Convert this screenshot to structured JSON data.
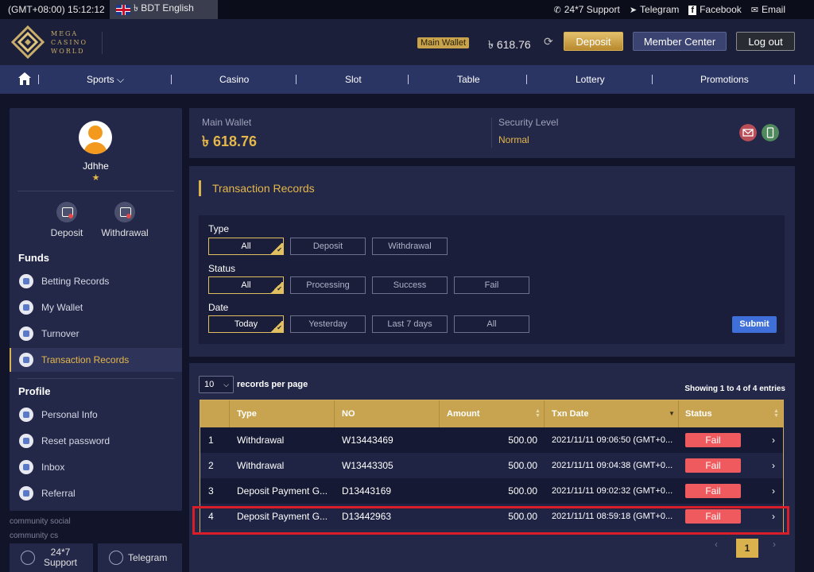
{
  "topbar": {
    "time": "(GMT+08:00) 15:12:12",
    "language": "৳ BDT English",
    "links": [
      {
        "icon": "phone-icon",
        "glyph": "✆",
        "label": "24*7 Support"
      },
      {
        "icon": "telegram-icon",
        "glyph": "➤",
        "label": "Telegram"
      },
      {
        "icon": "facebook-icon",
        "glyph": "f",
        "label": "Facebook"
      },
      {
        "icon": "email-icon",
        "glyph": "✉",
        "label": "Email"
      }
    ]
  },
  "header": {
    "logo_lines": [
      "MEGA",
      "CASINO",
      "WORLD"
    ],
    "wallet_label": "Main Wallet",
    "wallet_amount": "৳ 618.76",
    "deposit": "Deposit",
    "member_center": "Member Center",
    "logout": "Log out"
  },
  "nav": {
    "items": [
      "Sports ⌵",
      "Casino",
      "Slot",
      "Table",
      "Lottery",
      "Promotions"
    ]
  },
  "sidebar": {
    "username": "Jdhhe",
    "star": "★",
    "quick": [
      "Deposit",
      "Withdrawal"
    ],
    "funds_title": "Funds",
    "funds": [
      "Betting Records",
      "My Wallet",
      "Turnover",
      "Transaction Records"
    ],
    "profile_title": "Profile",
    "profile": [
      "Personal Info",
      "Reset password",
      "Inbox",
      "Referral"
    ],
    "community_social": "community social",
    "community_cs": "community cs",
    "cs_buttons": [
      "24*7 Support",
      "Telegram"
    ]
  },
  "wallet_card": {
    "main_label": "Main Wallet",
    "main_amount": "৳ 618.76",
    "security_label": "Security Level",
    "security_value": "Normal"
  },
  "transactions": {
    "title": "Transaction Records",
    "type_label": "Type",
    "type_options": [
      "All",
      "Deposit",
      "Withdrawal"
    ],
    "status_label": "Status",
    "status_options": [
      "All",
      "Processing",
      "Success",
      "Fail"
    ],
    "date_label": "Date",
    "date_options": [
      "Today",
      "Yesterday",
      "Last 7 days",
      "All"
    ],
    "submit": "Submit"
  },
  "records": {
    "per_page_value": "10",
    "per_page_label": "records per page",
    "showing": "Showing 1 to 4 of 4 entries",
    "columns": [
      "",
      "Type",
      "NO",
      "Amount",
      "Txn Date",
      "Status"
    ],
    "rows": [
      {
        "n": "1",
        "type": "Withdrawal",
        "no": "W13443469",
        "amount": "500.00",
        "date": "2021/11/11 09:06:50 (GMT+0...",
        "status": "Fail"
      },
      {
        "n": "2",
        "type": "Withdrawal",
        "no": "W13443305",
        "amount": "500.00",
        "date": "2021/11/11 09:04:38 (GMT+0...",
        "status": "Fail"
      },
      {
        "n": "3",
        "type": "Deposit Payment G...",
        "no": "D13443169",
        "amount": "500.00",
        "date": "2021/11/11 09:02:32 (GMT+0...",
        "status": "Fail"
      },
      {
        "n": "4",
        "type": "Deposit Payment G...",
        "no": "D13442963",
        "amount": "500.00",
        "date": "2021/11/11 08:59:18 (GMT+0...",
        "status": "Fail"
      }
    ],
    "pager": {
      "prev": "‹",
      "current": "1",
      "next": "›"
    }
  },
  "colors": {
    "gold": "#d9b24e",
    "fail": "#ef5a5e",
    "highlight": "#d91e2a",
    "nav": "#2a3564"
  }
}
